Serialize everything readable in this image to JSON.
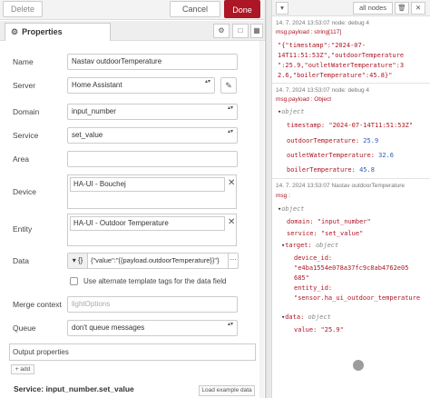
{
  "toolbar": {
    "delete_label": "Delete",
    "cancel_label": "Cancel",
    "done_label": "Done"
  },
  "tabs": {
    "properties_label": "Properties"
  },
  "form": {
    "name": {
      "label": "Name",
      "value": "Nastav outdoorTemperature"
    },
    "server": {
      "label": "Server",
      "value": "Home Assistant"
    },
    "domain": {
      "label": "Domain",
      "value": "input_number"
    },
    "service": {
      "label": "Service",
      "value": "set_value"
    },
    "area": {
      "label": "Area"
    },
    "device": {
      "label": "Device",
      "chip": "HA-UI - Bouchej"
    },
    "entity": {
      "label": "Entity",
      "chip": "HA-UI - Outdoor Temperature"
    },
    "data": {
      "label": "Data",
      "type_symbol": "{}",
      "value": "{\"value\":\"{{payload.outdoorTemperature}}\"}"
    },
    "alt_template": {
      "label": "Use alternate template tags for the data field",
      "checked": false
    },
    "merge_context": {
      "label": "Merge context",
      "placeholder": "lightOptions"
    },
    "queue": {
      "label": "Queue",
      "value": "don't queue messages"
    },
    "output_properties": {
      "label": "Output properties",
      "add_label": "+ add"
    },
    "service_footer": "Service: input_number.set_value",
    "example_label": "Load example data"
  },
  "debug": {
    "filter_label": "all nodes",
    "msg1": {
      "meta": "14. 7. 2024 13:53:07   node: debug 4",
      "type": "msg.payload : string[117]",
      "lines": [
        "\"{\"timestamp\":\"2024-07-",
        "14T11:51:53Z\",\"outdoorTemperature",
        "\":25.9,\"outletWaterTemperature\":3",
        "2.6,\"boilerTemperature\":45.8}\""
      ]
    },
    "msg2": {
      "meta": "14. 7. 2024 13:53:07   node: debug 4",
      "type": "msg.payload : Object",
      "object_label": "object",
      "fields": [
        {
          "key": "timestamp:",
          "value": "\"2024-07-14T11:51:53Z\"",
          "kind": "str"
        },
        {
          "key": "outdoorTemperature:",
          "value": "25.9",
          "kind": "num"
        },
        {
          "key": "outletWaterTemperature:",
          "value": "32.6",
          "kind": "num"
        },
        {
          "key": "boilerTemperature:",
          "value": "45.8",
          "kind": "num"
        }
      ]
    },
    "msg3": {
      "meta": "14. 7. 2024 13:53:07   Nastav outdoorTemperature",
      "type": "msg :",
      "object_label": "object",
      "domain_key": "domain:",
      "domain_val": "\"input_number\"",
      "service_key": "service:",
      "service_val": "\"set_value\"",
      "target_key": "target:",
      "target_type": "object",
      "device_key": "device_id:",
      "device_line1": "\"e4ba1554e078a37fc9c8ab4762e05",
      "device_line2": "685\"",
      "entity_key": "entity_id:",
      "entity_line": "\"sensor.ha_ui_outdoor_temperature",
      "data_key": "data:",
      "data_type": "object",
      "value_key": "value:",
      "value_val": "\"25.9\""
    }
  }
}
